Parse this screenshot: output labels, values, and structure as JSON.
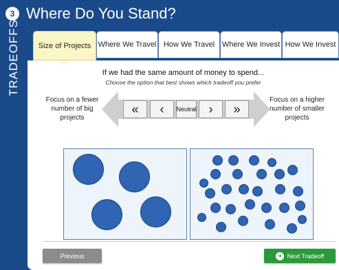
{
  "header": {
    "step_number": "3",
    "title": "Where Do You Stand?"
  },
  "sidebar": {
    "label": "TRADEOFFS"
  },
  "tabs": [
    {
      "label": "Size of Projects",
      "active": true
    },
    {
      "label": "Where We Travel",
      "active": false
    },
    {
      "label": "How We Travel",
      "active": false
    },
    {
      "label": "Where We Invest",
      "active": false
    },
    {
      "label": "How We Invest",
      "active": false
    }
  ],
  "question": {
    "prompt": "If we had the same amount of money to spend...",
    "subprompt": "Choose the option that best shows which tradeoff you prefer"
  },
  "options": {
    "left_label": "Focus on a fewer number of big projects",
    "right_label": "Focus on a higher number of smaller projects"
  },
  "scale": {
    "buttons": [
      {
        "label": "«",
        "icon": "double-chevron-left-icon"
      },
      {
        "label": "‹",
        "icon": "chevron-left-icon"
      },
      {
        "label": "Neutral"
      },
      {
        "label": "›",
        "icon": "chevron-right-icon"
      },
      {
        "label": "»",
        "icon": "double-chevron-right-icon"
      }
    ]
  },
  "illustrations": {
    "big_projects_count": 4,
    "small_projects_count": 28
  },
  "navigation": {
    "previous_label": "Previous",
    "next_label": "Next Tradeoff",
    "next_icon": "arrow-right-circle-icon"
  },
  "colors": {
    "primary_blue": "#1a4a8a",
    "active_tab": "#fbf6c5",
    "dot_blue": "#2f65b3",
    "next_green": "#2a9a3a",
    "previous_gray": "#8c8c8c"
  }
}
